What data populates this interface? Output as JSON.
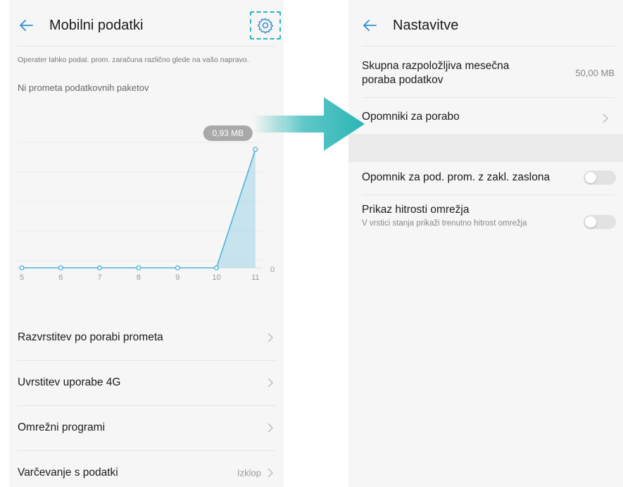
{
  "left": {
    "title": "Mobilni podatki",
    "note": "Operater lahko podat. prom. zaračuna različno glede na vašo napravo.",
    "subnote": "Ni prometa podatkovnih paketov",
    "chart_data": {
      "type": "area",
      "x": [
        "5",
        "6",
        "7",
        "8",
        "9",
        "10",
        "11"
      ],
      "values_mb": [
        0,
        0,
        0,
        0,
        0,
        0,
        0.93
      ],
      "callout": "0,93 MB",
      "y_zero_label": "0",
      "color": "#4fb3d9"
    },
    "rows": [
      {
        "label": "Razvrstitev po porabi prometa",
        "value": ""
      },
      {
        "label": "Uvrstitev uporabe 4G",
        "value": ""
      },
      {
        "label": "Omrežni programi",
        "value": ""
      },
      {
        "label": "Varčevanje s podatki",
        "value": "Izklop"
      }
    ]
  },
  "right": {
    "title": "Nastavitve",
    "monthly_title": "Skupna razpoložljiva mesečna poraba podatkov",
    "monthly_value": "50,00 MB",
    "reminders_title": "Opomniki za porabo",
    "lockscreen_title": "Opomnik za pod. prom. z zakl. zaslona",
    "lockscreen_on": false,
    "speed_title": "Prikaz hitrosti omrežja",
    "speed_sub": "V vrstici stanja prikaži trenutno hitrost omrežja",
    "speed_on": false
  },
  "colors": {
    "accent": "#2bb5b6",
    "arrow": "#2bb5b6",
    "chart_line": "#4fb3d9",
    "toggle_off": "#e2e2e2"
  }
}
